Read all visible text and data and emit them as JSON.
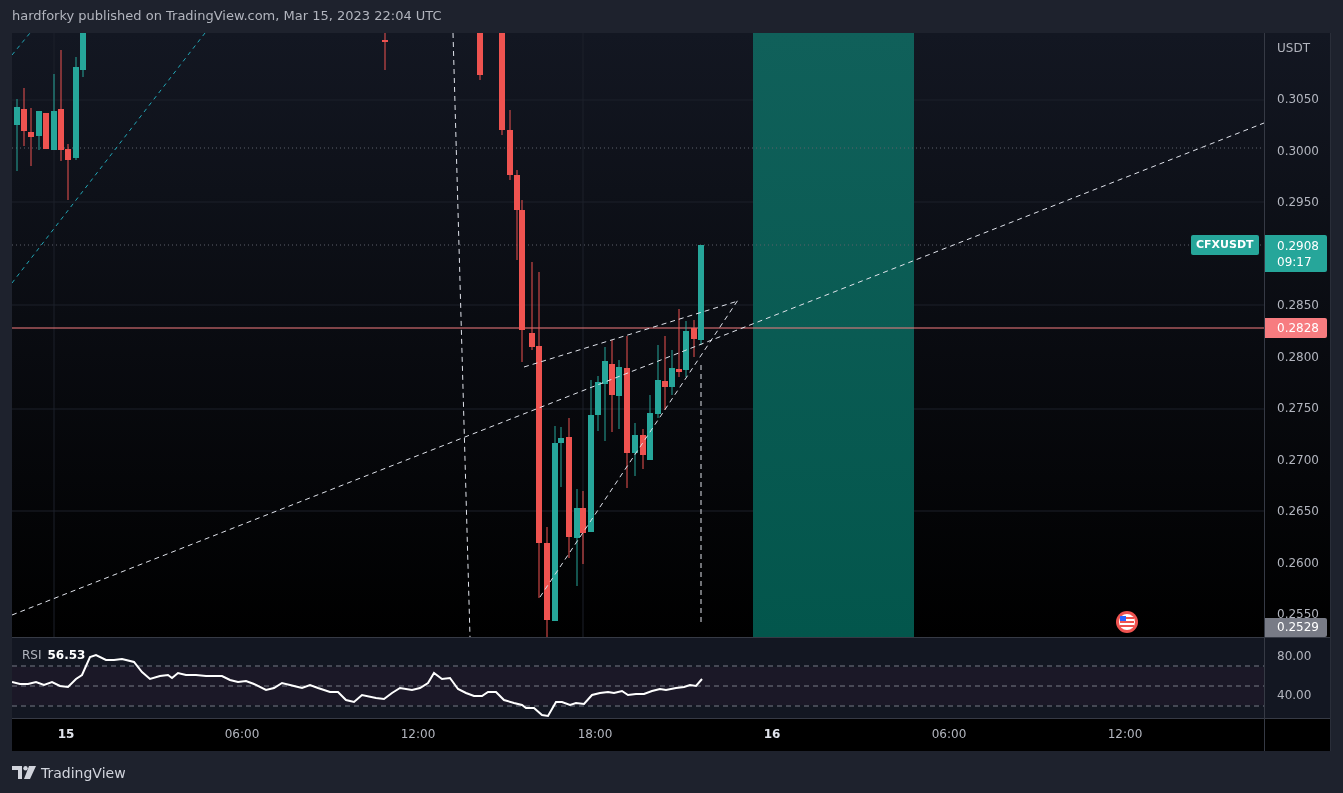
{
  "header": {
    "title": "hardforky published on TradingView.com, Mar 15, 2023 22:04 UTC"
  },
  "price_axis": {
    "currency": "USDT",
    "ticks": [
      "0.3050",
      "0.3000",
      "0.2950",
      "0.2850",
      "0.2800",
      "0.2750",
      "0.2700",
      "0.2650",
      "0.2600",
      "0.2550"
    ]
  },
  "symbol_label": {
    "symbol": "CFXUSDT",
    "price": "0.2908",
    "countdown": "09:17"
  },
  "line_label": "0.2828",
  "low_label": "0.2529",
  "rsi": {
    "name": "RSI",
    "value": "56.53",
    "ticks": [
      "80.00",
      "40.00"
    ]
  },
  "time_axis": [
    {
      "label": "15",
      "kind": "day"
    },
    {
      "label": "06:00",
      "kind": "time"
    },
    {
      "label": "12:00",
      "kind": "time"
    },
    {
      "label": "18:00",
      "kind": "time"
    },
    {
      "label": "16",
      "kind": "day"
    },
    {
      "label": "06:00",
      "kind": "time"
    },
    {
      "label": "12:00",
      "kind": "time"
    }
  ],
  "footer": {
    "brand": "TradingView"
  }
}
